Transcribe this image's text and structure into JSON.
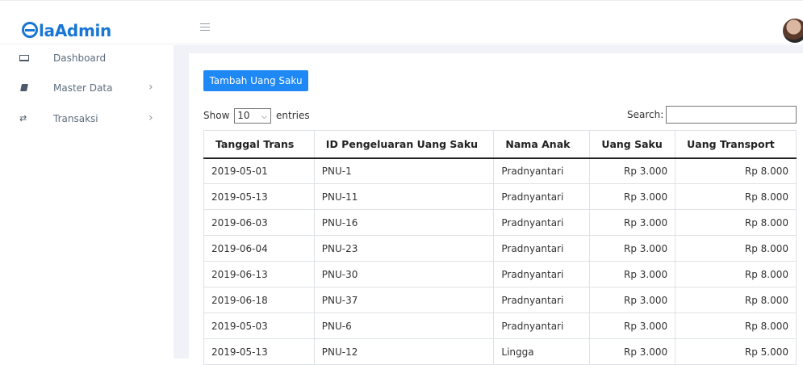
{
  "app": {
    "logo_text": "laAdmin"
  },
  "sidebar": {
    "items": [
      {
        "label": "Dashboard",
        "icon": "laptop-icon",
        "has_submenu": false
      },
      {
        "label": "Master Data",
        "icon": "book-icon",
        "has_submenu": true
      },
      {
        "label": "Transaksi",
        "icon": "exchange-icon",
        "has_submenu": true
      }
    ]
  },
  "toolbar": {
    "add_label": "Tambah Uang Saku"
  },
  "datatable": {
    "show_prefix": "Show",
    "page_length": "10",
    "show_suffix": "entries",
    "search_label": "Search:",
    "search_value": ""
  },
  "table": {
    "columns": [
      "Tanggal Trans",
      "ID Pengeluaran Uang Saku",
      "Nama Anak",
      "Uang Saku",
      "Uang Transport"
    ],
    "rows": [
      [
        "2019-05-01",
        "PNU-1",
        "Pradnyantari",
        "Rp 3.000",
        "Rp 8.000"
      ],
      [
        "2019-05-13",
        "PNU-11",
        "Pradnyantari",
        "Rp 3.000",
        "Rp 8.000"
      ],
      [
        "2019-06-03",
        "PNU-16",
        "Pradnyantari",
        "Rp 3.000",
        "Rp 8.000"
      ],
      [
        "2019-06-04",
        "PNU-23",
        "Pradnyantari",
        "Rp 3.000",
        "Rp 8.000"
      ],
      [
        "2019-06-13",
        "PNU-30",
        "Pradnyantari",
        "Rp 3.000",
        "Rp 8.000"
      ],
      [
        "2019-06-18",
        "PNU-37",
        "Pradnyantari",
        "Rp 3.000",
        "Rp 8.000"
      ],
      [
        "2019-05-03",
        "PNU-6",
        "Pradnyantari",
        "Rp 3.000",
        "Rp 8.000"
      ],
      [
        "2019-05-13",
        "PNU-12",
        "Lingga",
        "Rp 3.000",
        "Rp 5.000"
      ]
    ]
  },
  "colors": {
    "brand": "#1976d2",
    "primary_button": "#1e88f5",
    "gutter": "#f1f2f7"
  }
}
